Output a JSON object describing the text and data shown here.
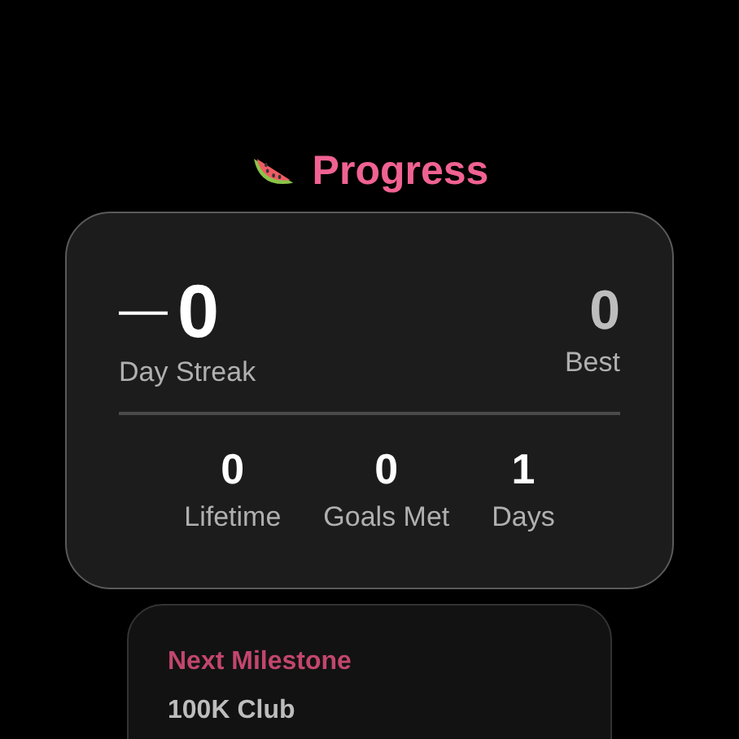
{
  "title": "Progress",
  "streak": {
    "prefix": "—",
    "value": "0",
    "label": "Day Streak"
  },
  "best": {
    "value": "0",
    "label": "Best"
  },
  "stats": [
    {
      "value": "0",
      "label": "Lifetime"
    },
    {
      "value": "0",
      "label": "Goals Met"
    },
    {
      "value": "1",
      "label": "Days"
    }
  ],
  "milestone": {
    "heading": "Next Milestone",
    "name": "100K Club"
  }
}
